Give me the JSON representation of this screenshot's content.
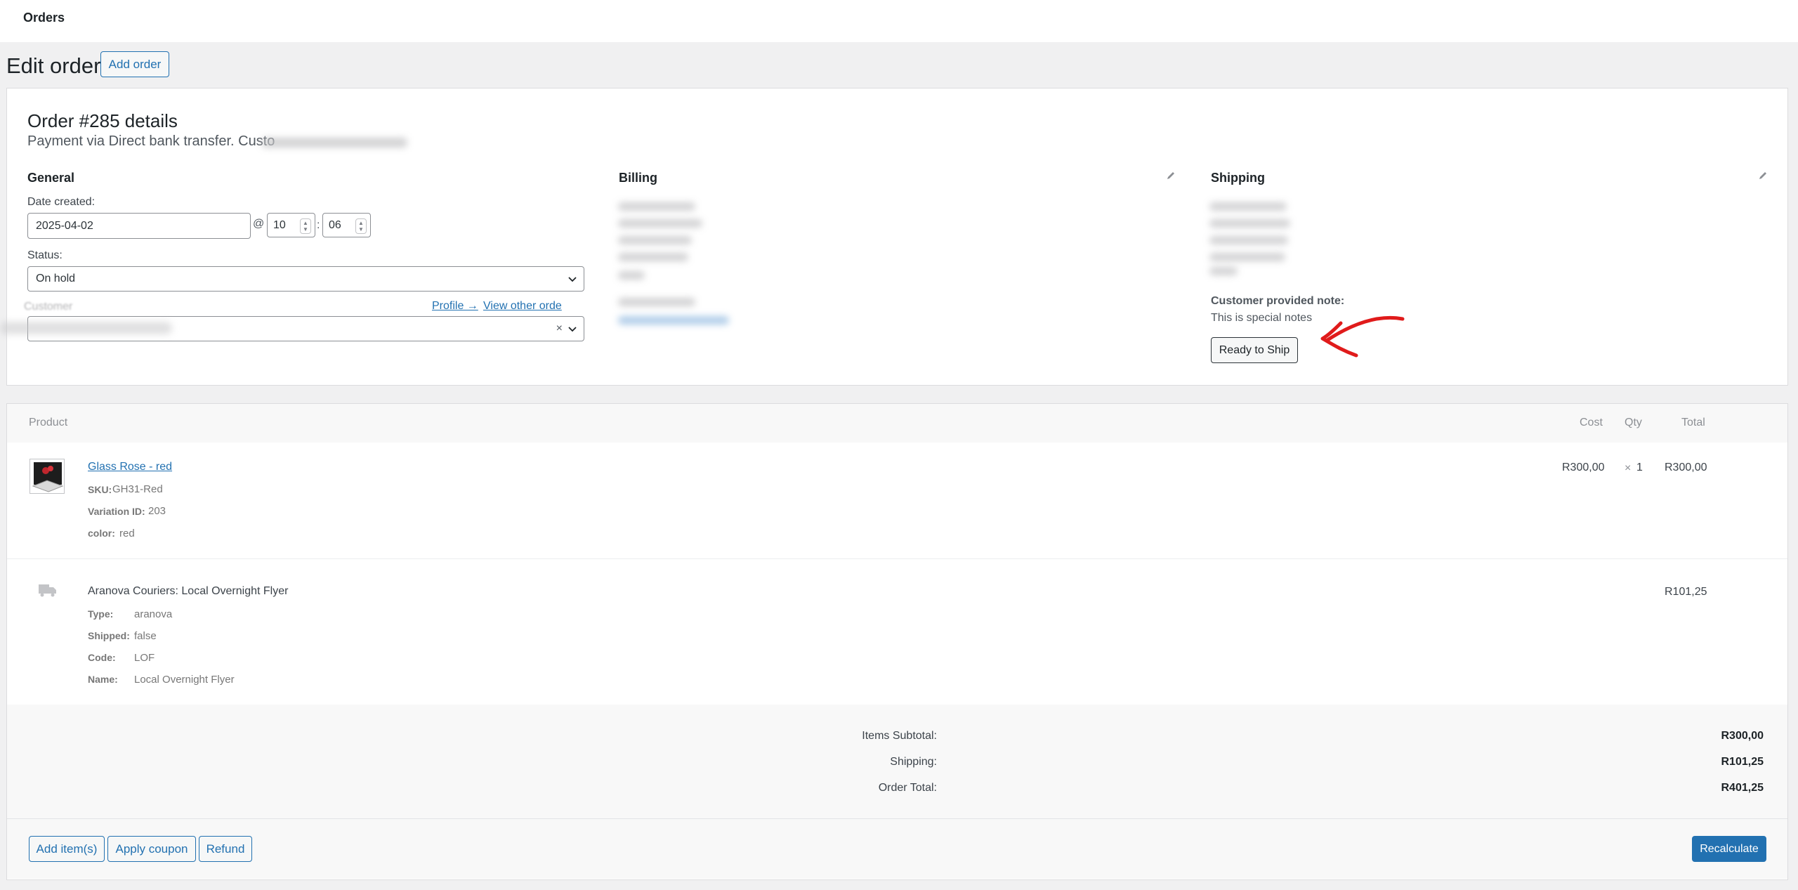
{
  "header": {
    "title": "Orders"
  },
  "page": {
    "heading": "Edit order",
    "add_order": "Add order"
  },
  "order": {
    "title": "Order #285 details",
    "payment_text": "Payment via Direct bank transfer. Custo"
  },
  "general": {
    "heading": "General",
    "date_label": "Date created:",
    "date_value": "2025-04-02",
    "at": "@",
    "hour": "10",
    "colon": ":",
    "minute": "06",
    "status_label": "Status:",
    "status_value": "On hold",
    "customer_label": "Customer",
    "profile_link": "Profile →",
    "view_other": "View other orde",
    "clear": "×"
  },
  "billing": {
    "heading": "Billing"
  },
  "shipping": {
    "heading": "Shipping",
    "note_label": "Customer provided note:",
    "note_text": "This is special notes",
    "ready_button": "Ready to Ship"
  },
  "items": {
    "columns": {
      "product": "Product",
      "cost": "Cost",
      "qty": "Qty",
      "total": "Total"
    },
    "product": {
      "name": "Glass Rose - red",
      "sku_label": "SKU:",
      "sku_value": "GH31-Red",
      "variation_label": "Variation ID:",
      "variation_value": "203",
      "color_label": "color:",
      "color_value": "red",
      "cost": "R300,00",
      "qty_times": "×",
      "qty": "1",
      "total": "R300,00"
    },
    "shipping_line": {
      "title": "Aranova Couriers: Local Overnight Flyer",
      "total": "R101,25",
      "meta": [
        {
          "key": "Type:",
          "value": "aranova"
        },
        {
          "key": "Shipped:",
          "value": "false"
        },
        {
          "key": "Code:",
          "value": "LOF"
        },
        {
          "key": "Name:",
          "value": "Local Overnight Flyer"
        }
      ]
    }
  },
  "totals": {
    "items_subtotal_label": "Items Subtotal:",
    "items_subtotal": "R300,00",
    "shipping_label": "Shipping:",
    "shipping": "R101,25",
    "order_total_label": "Order Total:",
    "order_total": "R401,25"
  },
  "actions": {
    "add_items": "Add item(s)",
    "apply_coupon": "Apply coupon",
    "refund": "Refund",
    "recalculate": "Recalculate"
  },
  "colors": {
    "accent": "#2271b1",
    "annotation": "#e01b1b"
  }
}
